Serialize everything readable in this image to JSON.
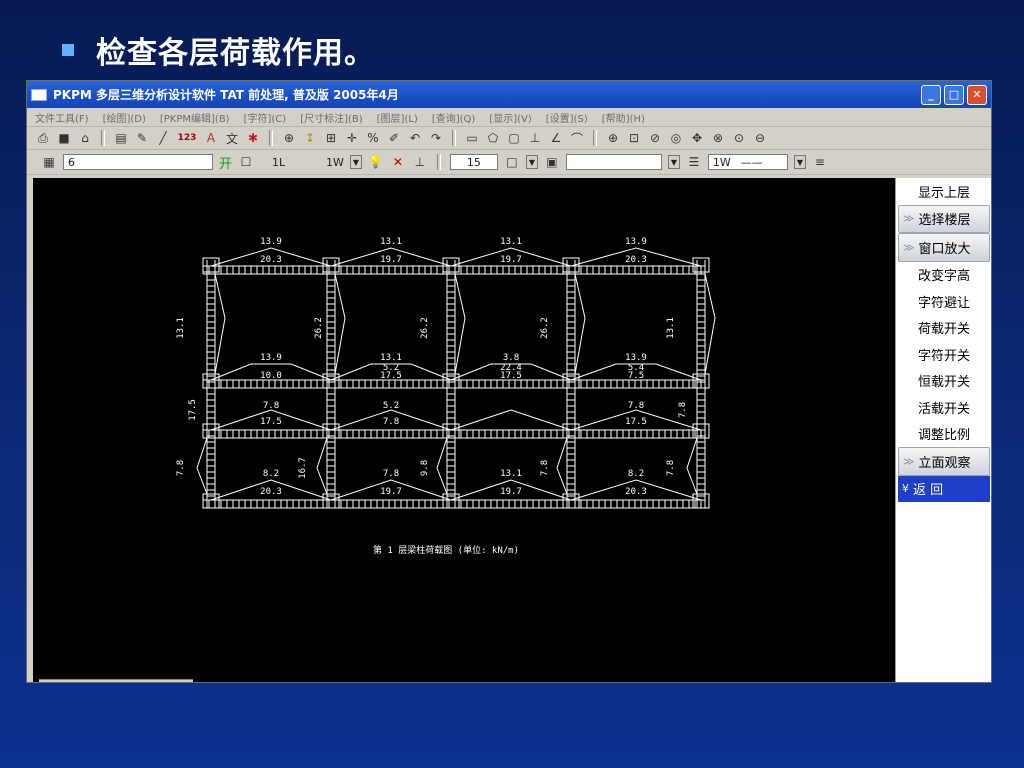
{
  "slide": {
    "title": "检查各层荷载作用。"
  },
  "window": {
    "title": "PKPM 多层三维分析设计软件 TAT 前处理, 普及版 2005年4月"
  },
  "menu": {
    "items": [
      "文件工具(F)",
      "[绘图](D)",
      "[PKPM编辑](B)",
      "[字符](C)",
      "[尺寸标注](B)",
      "[图层](L)",
      "[查询](Q)",
      "[显示](V)",
      "[设置](S)",
      "[帮助](H)"
    ]
  },
  "toolbar1": {
    "icons": [
      "print-icon",
      "save-icon",
      "open-icon",
      "layer-icon",
      "brush-icon",
      "line-icon",
      "123-icon",
      "text-icon",
      "chinese-icon",
      "redraw-icon",
      "pan-icon",
      "move-icon",
      "grid-icon",
      "crosshair-icon",
      "snap-icon",
      "pen-icon",
      "undo-icon",
      "redo-icon",
      "rect-icon",
      "polygon-icon",
      "box-icon",
      "line-tool-icon",
      "angle-icon",
      "arc-icon",
      "zoom-in-icon",
      "zoom-window-icon",
      "zoom-prev-icon",
      "zoom-all-icon",
      "zoom-dynamic-icon",
      "zoom-extent-icon",
      "zoom-icon",
      "zoom-out-icon"
    ],
    "label_123": "123"
  },
  "toolbar2": {
    "layer_value": "6",
    "open_label": "开",
    "layer_name": "1L",
    "linetype": "1W",
    "number_value": "15",
    "color_value": "",
    "lineweight": "1W"
  },
  "side_panel": {
    "items": [
      "显示上层",
      "选择楼层",
      "窗口放大",
      "改变字高",
      "字符避让",
      "荷载开关",
      "字符开关",
      "恒载开关",
      "活载开关",
      "调整比例",
      "立面观察",
      "返  回"
    ]
  },
  "drawing": {
    "caption": "第 1 层梁柱荷载图 (单位: kN/m)",
    "beam_labels": {
      "r1_top": [
        "13.9",
        "13.1",
        "13.1",
        "13.9"
      ],
      "r1_bot": [
        "20.3",
        "19.7",
        "19.7",
        "20.3"
      ],
      "r2_top": [
        "13.9",
        "13.1",
        "3.8",
        "13.9"
      ],
      "r2_mid": [
        "",
        "5.2",
        "22.4",
        "5.4"
      ],
      "r2_bot": [
        "10.0",
        "17.5",
        "17.5",
        "7.5"
      ],
      "r3_top": [
        "7.8",
        "5.2",
        "",
        "7.8"
      ],
      "r3_bot": [
        "17.5",
        "7.8",
        "",
        "17.5"
      ],
      "r4_top": [
        "8.2",
        "7.8",
        "13.1",
        "8.2"
      ],
      "r4_bot": [
        "20.3",
        "19.7",
        "19.7",
        "20.3"
      ],
      "col_labels": [
        "13.1",
        "26.2",
        "26.2",
        "26.2",
        "13.1",
        "17.5",
        "7.8",
        "16.7",
        "9.8",
        "7.8",
        "7.8",
        "7.8"
      ]
    }
  },
  "colors": {
    "slide_bg": "#0b2a78",
    "titlebar": "#1a4fc2",
    "canvas": "#000000",
    "drawing": "#ffffff",
    "active_side": "#1f3fc8"
  }
}
